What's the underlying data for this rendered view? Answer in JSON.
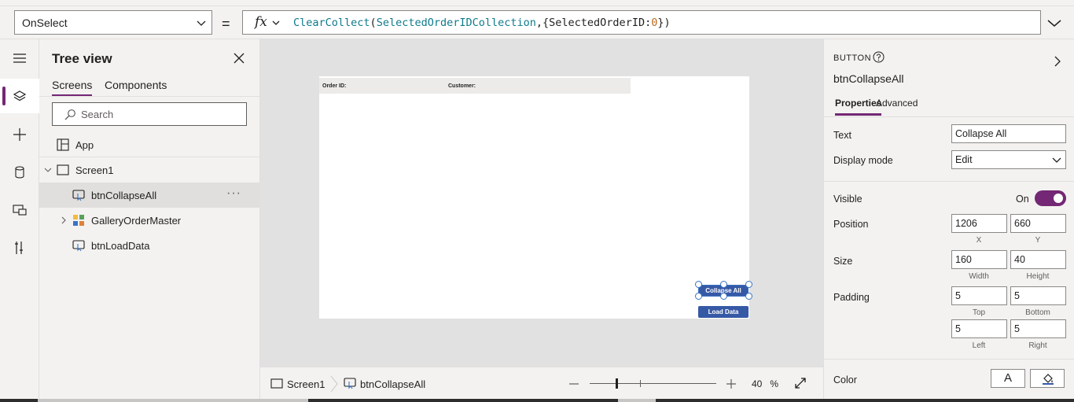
{
  "formula_bar": {
    "property": "OnSelect",
    "equals": "=",
    "fx": "fx",
    "formula_parts": {
      "fn": "ClearCollect",
      "p1": "(",
      "collection": "SelectedOrderIDCollection",
      "p2": ",{",
      "field": "SelectedOrderID",
      "p3": ":",
      "value": "0",
      "p4": "})"
    }
  },
  "tree_view": {
    "title": "Tree view",
    "tabs": [
      "Screens",
      "Components"
    ],
    "search_placeholder": "Search",
    "nodes": {
      "app": "App",
      "screen": "Screen1",
      "btn_collapse": "btnCollapseAll",
      "gallery": "GalleryOrderMaster",
      "btn_load": "btnLoadData"
    },
    "more": "···"
  },
  "canvas": {
    "gallery_header": {
      "order_id": "Order ID:",
      "customer": "Customer:"
    },
    "collapse_button": "Collapse All",
    "load_button": "Load Data"
  },
  "status_bar": {
    "screen": "Screen1",
    "control": "btnCollapseAll",
    "zoom_value": "40",
    "zoom_unit": "%",
    "zoom_level": 0.4
  },
  "properties": {
    "control_type": "BUTTON",
    "control_name": "btnCollapseAll",
    "tabs": [
      "Properties",
      "Advanced"
    ],
    "text_label": "Text",
    "text_value": "Collapse All",
    "display_mode_label": "Display mode",
    "display_mode_value": "Edit",
    "visible_label": "Visible",
    "visible_value": "On",
    "position_label": "Position",
    "position_x": "1206",
    "position_y": "660",
    "x_caption": "X",
    "y_caption": "Y",
    "size_label": "Size",
    "size_width": "160",
    "size_height": "40",
    "width_caption": "Width",
    "height_caption": "Height",
    "padding_label": "Padding",
    "padding_top": "5",
    "padding_bottom": "5",
    "padding_left": "5",
    "padding_right": "5",
    "top_caption": "Top",
    "bottom_caption": "Bottom",
    "left_caption": "Left",
    "right_caption": "Right",
    "color_label": "Color",
    "color_text_glyph": "A"
  },
  "colors": {
    "accent": "#742774",
    "button_fill": "#3659a6",
    "selection": "#3a73c3"
  }
}
